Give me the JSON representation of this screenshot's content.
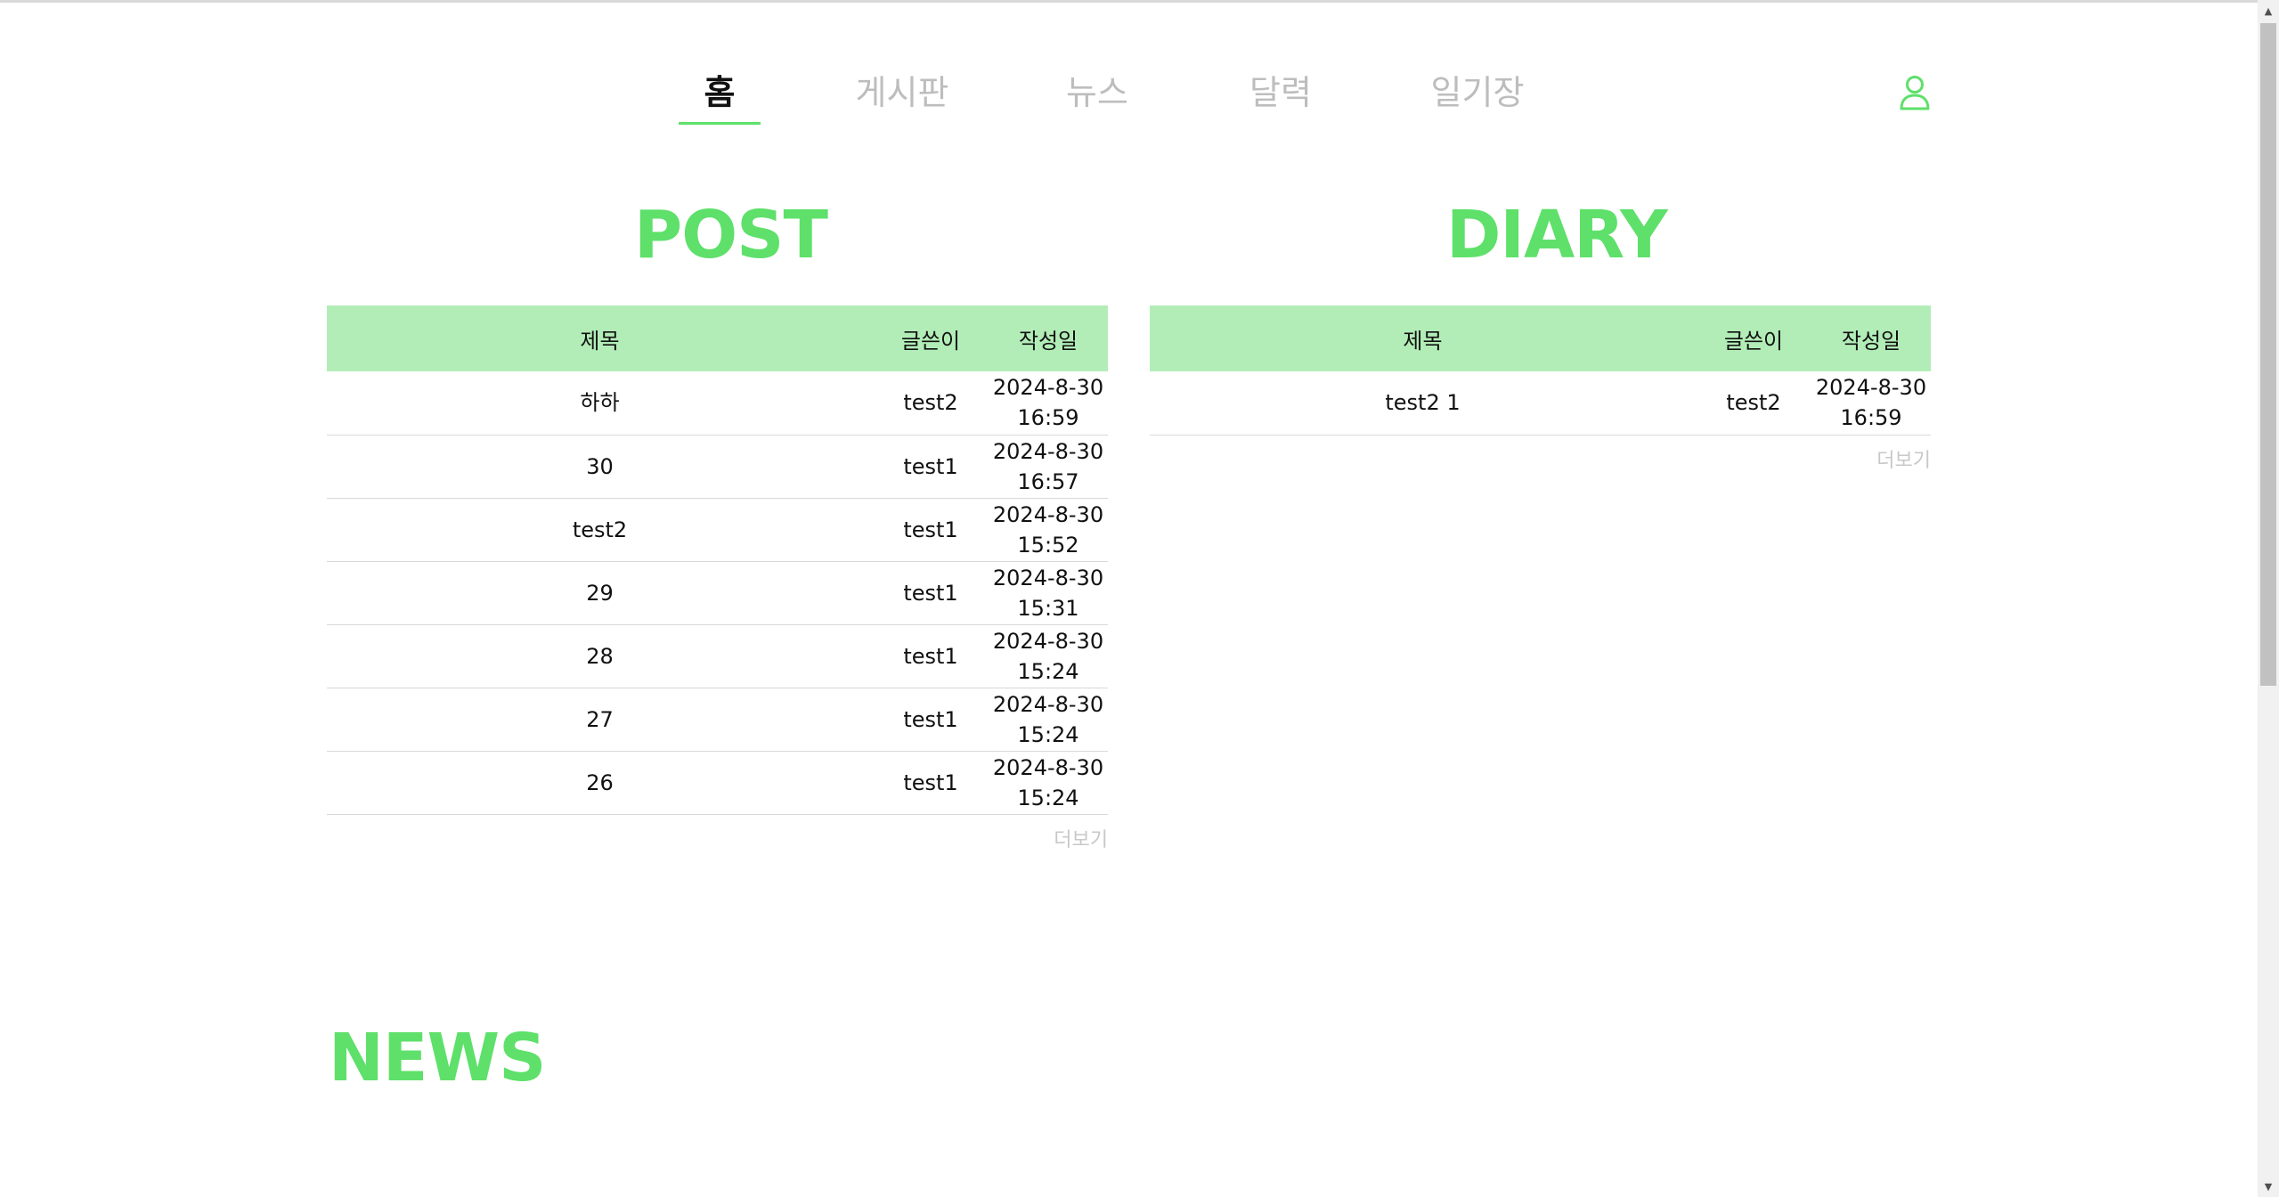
{
  "nav": {
    "items": [
      {
        "label": "홈",
        "active": true
      },
      {
        "label": "게시판",
        "active": false
      },
      {
        "label": "뉴스",
        "active": false
      },
      {
        "label": "달력",
        "active": false
      },
      {
        "label": "일기장",
        "active": false
      }
    ],
    "user_icon": "user-icon"
  },
  "colors": {
    "accent": "#5ee06a",
    "table_header": "#b2edb7",
    "muted": "#bdbdbd"
  },
  "post": {
    "title": "POST",
    "headers": {
      "title": "제목",
      "writer": "글쓴이",
      "date": "작성일"
    },
    "rows": [
      {
        "title": "하하",
        "writer": "test2",
        "date": "2024-8-30",
        "time": "16:59"
      },
      {
        "title": "30",
        "writer": "test1",
        "date": "2024-8-30",
        "time": "16:57"
      },
      {
        "title": "test2",
        "writer": "test1",
        "date": "2024-8-30",
        "time": "15:52"
      },
      {
        "title": "29",
        "writer": "test1",
        "date": "2024-8-30",
        "time": "15:31"
      },
      {
        "title": "28",
        "writer": "test1",
        "date": "2024-8-30",
        "time": "15:24"
      },
      {
        "title": "27",
        "writer": "test1",
        "date": "2024-8-30",
        "time": "15:24"
      },
      {
        "title": "26",
        "writer": "test1",
        "date": "2024-8-30",
        "time": "15:24"
      }
    ],
    "more_label": "더보기"
  },
  "diary": {
    "title": "DIARY",
    "headers": {
      "title": "제목",
      "writer": "글쓴이",
      "date": "작성일"
    },
    "rows": [
      {
        "title": "test2 1",
        "writer": "test2",
        "date": "2024-8-30",
        "time": "16:59"
      }
    ],
    "more_label": "더보기"
  },
  "news": {
    "title": "NEWS"
  }
}
